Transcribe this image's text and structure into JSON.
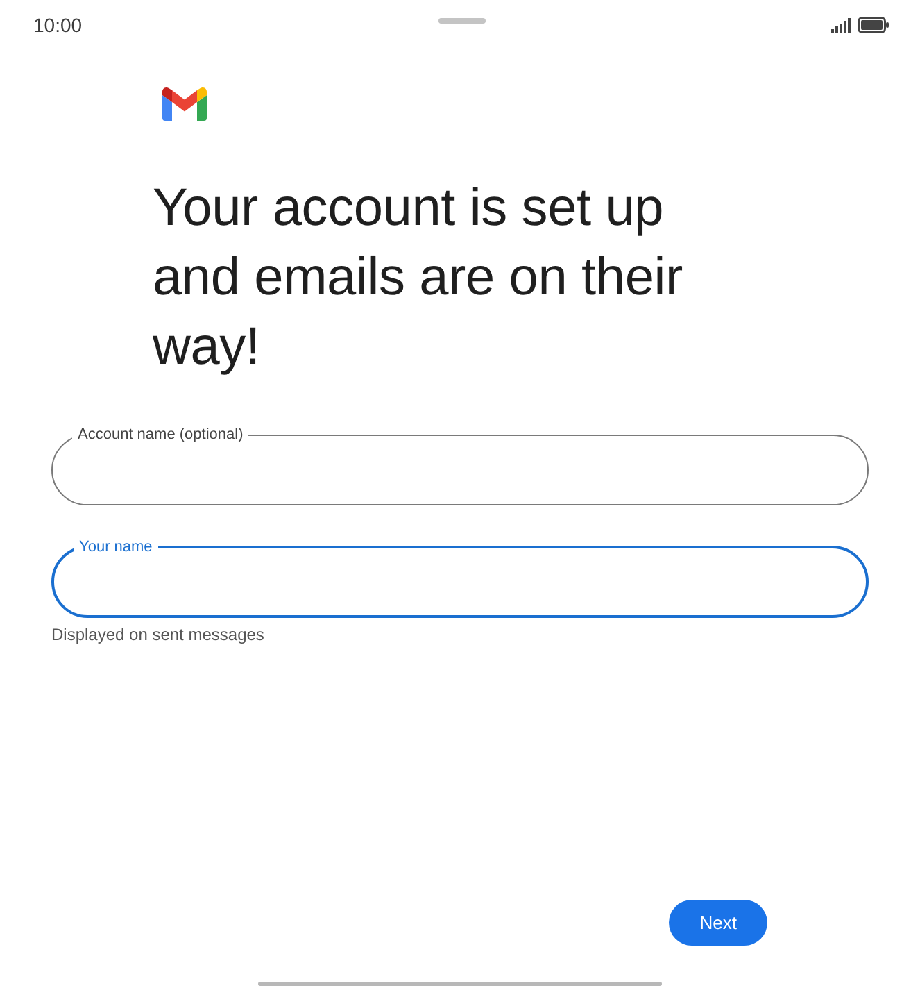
{
  "status_bar": {
    "time": "10:00"
  },
  "heading": "Your account is set up and emails are on their way!",
  "fields": [
    {
      "label": "Account name (optional)",
      "focused": false
    },
    {
      "label": "Your name",
      "focused": true,
      "helper": "Displayed on sent messages"
    }
  ],
  "next_button": {
    "label": "Next"
  }
}
